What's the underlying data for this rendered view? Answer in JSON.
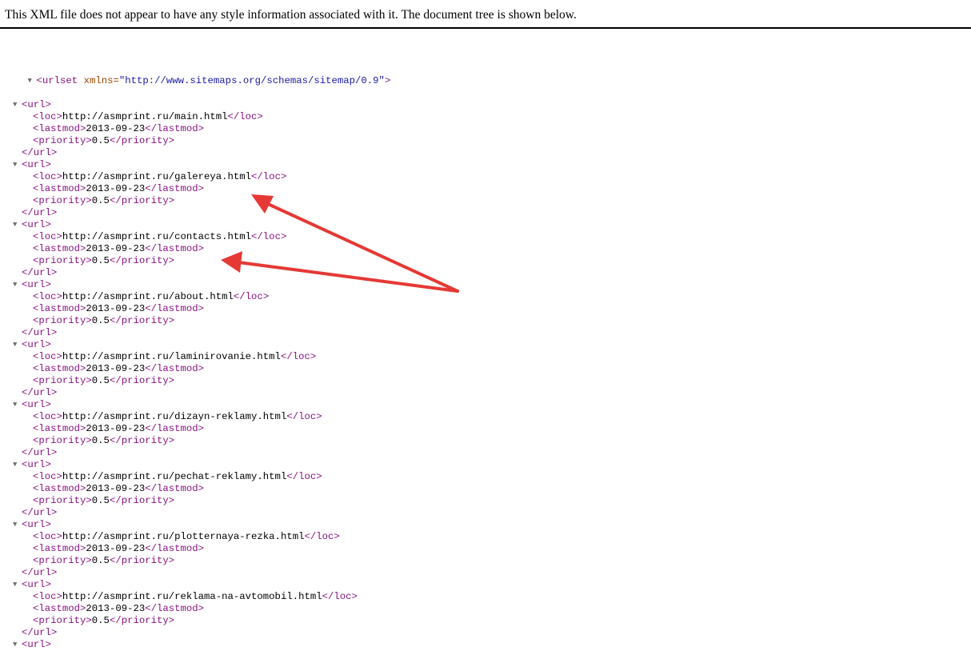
{
  "notice": "This XML file does not appear to have any style information associated with it. The document tree is shown below.",
  "root": {
    "open_tag": "<urlset ",
    "attr_name": "xmlns=",
    "attr_value": "\"http://www.sitemaps.org/schemas/sitemap/0.9\"",
    "open_close": ">"
  },
  "fold_icon": "▼",
  "tags": {
    "url_open": "<url>",
    "url_close": "</url>",
    "loc_open": "<loc>",
    "loc_close": "</loc>",
    "lastmod_open": "<lastmod>",
    "lastmod_close": "</lastmod>",
    "priority_open": "<priority>",
    "priority_close": "</priority>"
  },
  "urls": [
    {
      "loc": "http://asmprint.ru/main.html",
      "lastmod": "2013-09-23",
      "priority": "0.5"
    },
    {
      "loc": "http://asmprint.ru/galereya.html",
      "lastmod": "2013-09-23",
      "priority": "0.5"
    },
    {
      "loc": "http://asmprint.ru/contacts.html",
      "lastmod": "2013-09-23",
      "priority": "0.5"
    },
    {
      "loc": "http://asmprint.ru/about.html",
      "lastmod": "2013-09-23",
      "priority": "0.5"
    },
    {
      "loc": "http://asmprint.ru/laminirovanie.html",
      "lastmod": "2013-09-23",
      "priority": "0.5"
    },
    {
      "loc": "http://asmprint.ru/dizayn-reklamy.html",
      "lastmod": "2013-09-23",
      "priority": "0.5"
    },
    {
      "loc": "http://asmprint.ru/pechat-reklamy.html",
      "lastmod": "2013-09-23",
      "priority": "0.5"
    },
    {
      "loc": "http://asmprint.ru/plotternaya-rezka.html",
      "lastmod": "2013-09-23",
      "priority": "0.5"
    },
    {
      "loc": "http://asmprint.ru/reklama-na-avtomobil.html",
      "lastmod": "2013-09-23",
      "priority": "0.5"
    }
  ],
  "annotation_color": "#e53935"
}
